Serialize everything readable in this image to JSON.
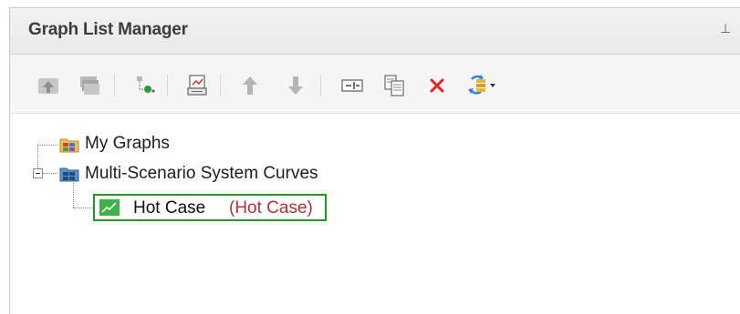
{
  "panel": {
    "title": "Graph List Manager",
    "pin_glyph": "⊥"
  },
  "toolbar": {
    "buttons": [
      {
        "name": "upload-graph-icon"
      },
      {
        "name": "stack-graph-icon"
      },
      {
        "name": "add-node-icon"
      },
      {
        "name": "print-graph-icon"
      },
      {
        "name": "move-up-icon"
      },
      {
        "name": "move-down-icon"
      },
      {
        "name": "rename-icon"
      },
      {
        "name": "copy-icon"
      },
      {
        "name": "delete-icon"
      },
      {
        "name": "refresh-dropdown-icon"
      }
    ]
  },
  "tree": {
    "items": [
      {
        "label": "My Graphs",
        "icon": "folder-icon"
      },
      {
        "label": "Multi-Scenario System Curves",
        "icon": "grid-folder-icon",
        "expanded": true
      },
      {
        "label": "Hot Case",
        "scenario": "(Hot Case)",
        "icon": "line-graph-icon",
        "selected": true
      }
    ]
  },
  "colors": {
    "selected_border": "#1e9a1e",
    "scenario_text": "#b03434",
    "delete": "#e32222"
  }
}
